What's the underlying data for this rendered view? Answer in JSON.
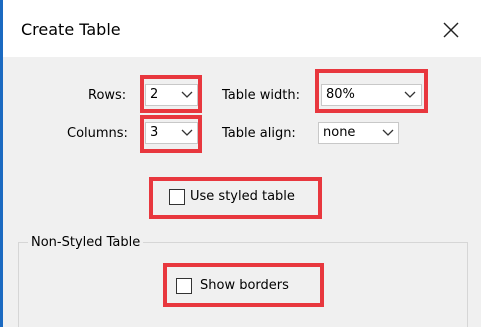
{
  "dialog": {
    "title": "Create Table",
    "close_icon": "close-icon"
  },
  "rows": {
    "label": "Rows:",
    "value": "2"
  },
  "columns": {
    "label": "Columns:",
    "value": "3"
  },
  "table_width": {
    "label": "Table width:",
    "value": "80%"
  },
  "table_align": {
    "label": "Table align:",
    "value": "none"
  },
  "styled_table": {
    "label": "Use styled table",
    "checked": false
  },
  "non_styled_group": {
    "title": "Non-Styled Table",
    "show_borders": {
      "label": "Show borders",
      "checked": false
    }
  },
  "colors": {
    "highlight": "#e8373e",
    "window_border": "#1b6ac1",
    "client_bg": "#f0f0f0"
  }
}
